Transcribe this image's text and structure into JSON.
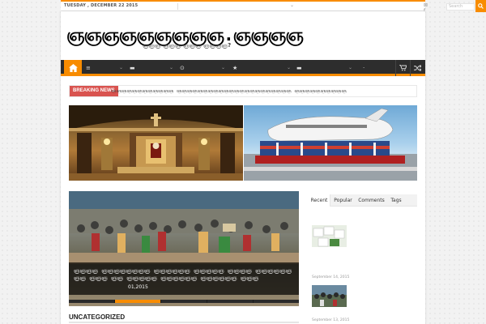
{
  "topbar": {
    "date": "TUESDAY , DECEMBER 22 2015",
    "menu_chevron": "⌄",
    "socials": "⊠ f ᵗ",
    "search_placeholder": "Search",
    "search_icon": "search-icon"
  },
  "header": {
    "logo": "ஞஞஞஞஞஞஞஞஞ.ஞஞஞஞ",
    "tagline": "ஞஞஞ ஞஞஞ ஞஞஞ ஞஞஞஞ?"
  },
  "nav": {
    "home_icon": "home-icon",
    "items": [
      {
        "icon": "≡",
        "chev": "⌄"
      },
      {
        "icon": "▬",
        "chev": "⌄"
      },
      {
        "icon": "⊙",
        "chev": "⌄"
      },
      {
        "icon": "★",
        "chev": "⌄"
      },
      {
        "icon": "▬",
        "chev": "⌄"
      },
      {
        "icon": "·",
        "chev": ""
      }
    ],
    "cart_icon": "cart-icon",
    "shuffle_icon": "shuffle-icon"
  },
  "breaking": {
    "label": "BREAKING NEWS",
    "text": "ஞஞஞஞஞஞஞஞஞஞஞஞ ஞஞஞஞஞஞஞஞஞஞஞஞஞஞஞஞஞஞஞஞஞஞ ஞஞஞஞஞஞஞஞஞஞ"
  },
  "feature": {
    "title": "ஞஞஞஞ ஞஞஞஞஞஞஞஞ ஞஞஞஞஞஞ ஞஞஞஞஞ ஞஞஞஞ ஞஞஞஞஞஞஞஞ ஞஞஞ ஞஞ ஞஞஞஞஞ ஞஞஞஞஞஞ ஞஞஞஞஞஞ ஞஞஞ",
    "date": "01,2015",
    "active_segment": 1
  },
  "section": {
    "title": "UNCATEGORIZED"
  },
  "widget": {
    "tabs": [
      "Recent",
      "Popular",
      "Comments",
      "Tags"
    ],
    "posts": [
      {
        "date": "September 14, 2015"
      },
      {
        "date": "September 13, 2015"
      }
    ]
  },
  "colors": {
    "accent": "#f88c00",
    "nav": "#2d2d2d",
    "breaking": "#d9534f"
  }
}
